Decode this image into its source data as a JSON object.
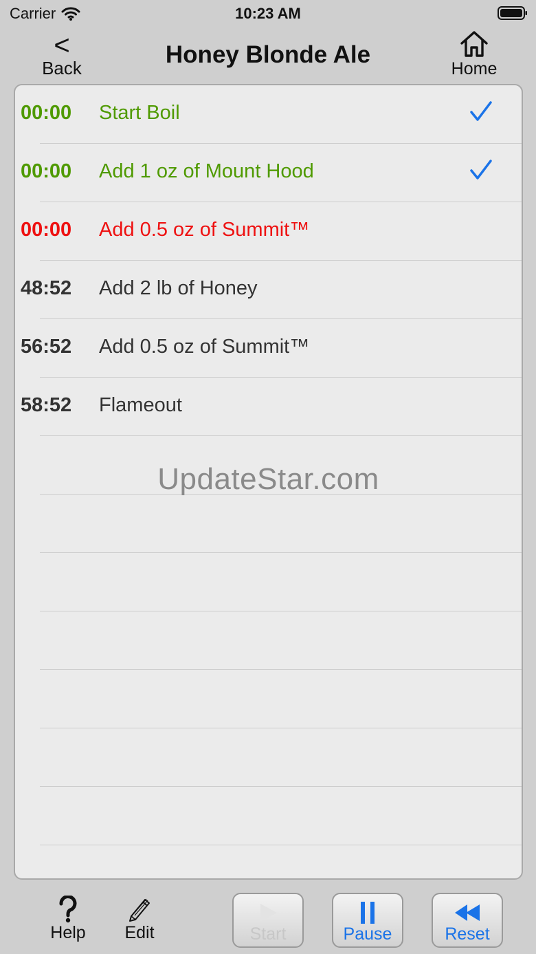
{
  "status_bar": {
    "carrier": "Carrier",
    "time": "10:23 AM"
  },
  "nav": {
    "back_label": "Back",
    "back_glyph": "<",
    "title": "Honey Blonde Ale",
    "home_label": "Home"
  },
  "steps": [
    {
      "time": "00:00",
      "label": "Start Boil",
      "state": "done",
      "checked": true
    },
    {
      "time": "00:00",
      "label": "Add 1 oz of Mount Hood",
      "state": "done",
      "checked": true
    },
    {
      "time": "00:00",
      "label": "Add 0.5 oz of Summit™",
      "state": "current",
      "checked": false
    },
    {
      "time": "48:52",
      "label": "Add 2 lb of Honey",
      "state": "pending",
      "checked": false
    },
    {
      "time": "56:52",
      "label": "Add 0.5 oz of Summit™",
      "state": "pending",
      "checked": false
    },
    {
      "time": "58:52",
      "label": "Flameout",
      "state": "pending",
      "checked": false
    }
  ],
  "watermark": "UpdateStar.com",
  "toolbar": {
    "help_label": "Help",
    "edit_label": "Edit",
    "start_label": "Start",
    "pause_label": "Pause",
    "reset_label": "Reset"
  },
  "colors": {
    "done": "#4f9a00",
    "current": "#ee1111",
    "pending": "#333333",
    "accent": "#1a73e8"
  },
  "icons": {
    "back": "chevron-left-icon",
    "home": "house-icon",
    "check": "checkmark-icon",
    "help": "question-icon",
    "edit": "pencil-icon",
    "start": "play-icon",
    "pause": "pause-icon",
    "reset": "rewind-icon"
  }
}
